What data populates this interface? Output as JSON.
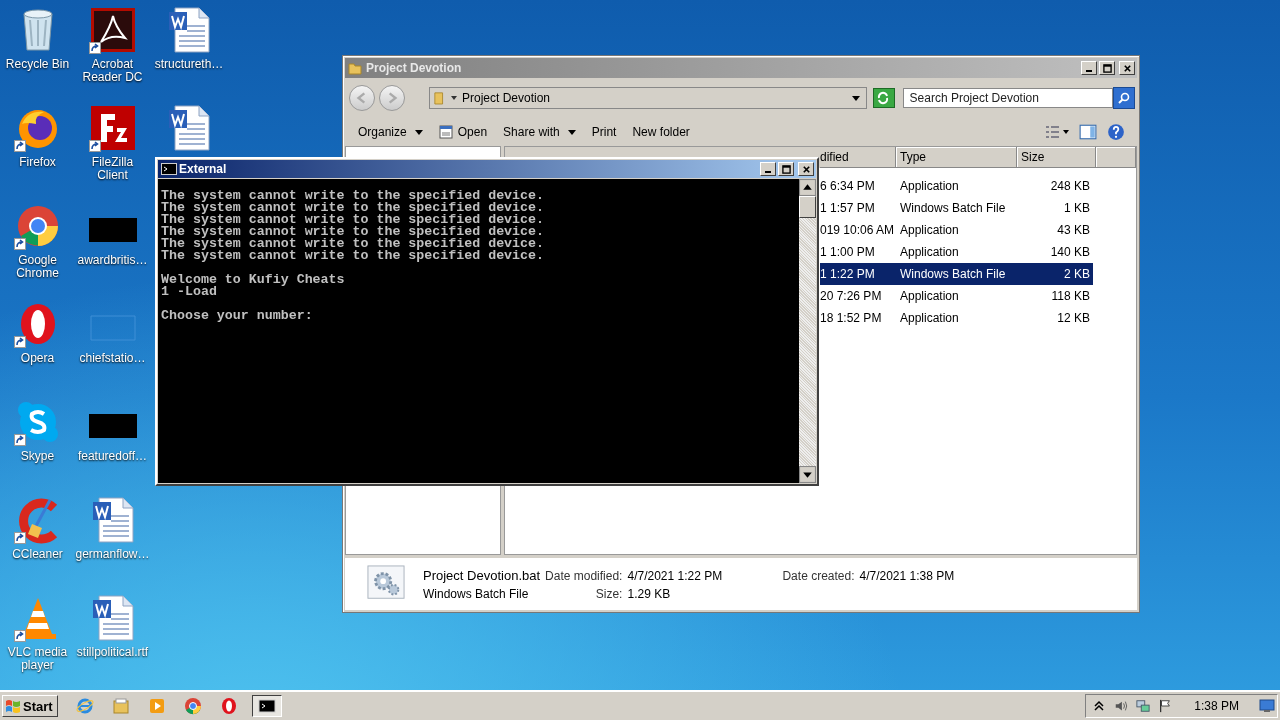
{
  "desktop_icons": [
    {
      "label": "Recycle Bin",
      "kind": "recycle",
      "shortcut": false
    },
    {
      "label": "Firefox",
      "kind": "firefox",
      "shortcut": true
    },
    {
      "label": "Google Chrome",
      "kind": "chrome",
      "shortcut": true
    },
    {
      "label": "Opera",
      "kind": "opera",
      "shortcut": true
    },
    {
      "label": "Skype",
      "kind": "skype",
      "shortcut": true
    },
    {
      "label": "CCleaner",
      "kind": "ccleaner",
      "shortcut": true
    },
    {
      "label": "VLC media player",
      "kind": "vlc",
      "shortcut": true
    },
    {
      "label": "Acrobat Reader DC",
      "kind": "acrobat",
      "shortcut": true
    },
    {
      "label": "FileZilla Client",
      "kind": "filezilla",
      "shortcut": true
    },
    {
      "label": "awardbritis…",
      "kind": "dark-thumb",
      "shortcut": false
    },
    {
      "label": "chiefstatio…",
      "kind": "light-thumb",
      "shortcut": false
    },
    {
      "label": "featuredoff…",
      "kind": "dark-thumb",
      "shortcut": false
    },
    {
      "label": "germanflow…",
      "kind": "word",
      "shortcut": false
    },
    {
      "label": "stillpolitical.rtf",
      "kind": "word",
      "shortcut": false
    },
    {
      "label": "structureth…",
      "kind": "word",
      "shortcut": false
    },
    {
      "kind": "word",
      "shortcut": false
    }
  ],
  "explorer": {
    "title": "Project Devotion",
    "address": "Project Devotion",
    "search_placeholder": "Search Project Devotion",
    "toolbar": [
      {
        "label": "Organize",
        "kind": "menu"
      },
      {
        "label": "Open",
        "kind": "open"
      },
      {
        "label": "Share with",
        "kind": "menu"
      },
      {
        "label": "Print",
        "kind": "plain"
      },
      {
        "label": "New folder",
        "kind": "plain"
      }
    ],
    "columns": [
      "dified",
      "Type",
      "Size"
    ],
    "rows": [
      {
        "date": "6 6:34 PM",
        "type": "Application",
        "size": "248 KB",
        "selected": false
      },
      {
        "date": "1 1:57 PM",
        "type": "Windows Batch File",
        "size": "1 KB",
        "selected": false
      },
      {
        "date": "019 10:06 AM",
        "type": "Application",
        "size": "43 KB",
        "selected": false
      },
      {
        "date": "1 1:00 PM",
        "type": "Application",
        "size": "140 KB",
        "selected": false
      },
      {
        "date": "1 1:22 PM",
        "type": "Windows Batch File",
        "size": "2 KB",
        "selected": true
      },
      {
        "date": "20 7:26 PM",
        "type": "Application",
        "size": "118 KB",
        "selected": false
      },
      {
        "date": "18 1:52 PM",
        "type": "Application",
        "size": "12 KB",
        "selected": false
      }
    ],
    "details": {
      "name": "Project Devotion.bat",
      "type": "Windows Batch File",
      "modified_label": "Date modified:",
      "modified": "4/7/2021 1:22 PM",
      "size_label": "Size:",
      "size": "1.29 KB",
      "created_label": "Date created:",
      "created": "4/7/2021 1:38 PM"
    }
  },
  "console": {
    "title": "External",
    "blocks": [
      [
        "The system cannot write to the specified device.",
        "The system cannot write to the specified device.",
        "The system cannot write to the specified device.",
        "The system cannot write to the specified device.",
        "The system cannot write to the specified device.",
        "The system cannot write to the specified device."
      ],
      [
        "Welcome to Kufiy Cheats",
        "1 -Load"
      ],
      [
        "Choose your number:"
      ]
    ]
  },
  "taskbar": {
    "start": "Start",
    "apps": [
      {
        "kind": "ie",
        "active": false
      },
      {
        "kind": "explorer",
        "active": false
      },
      {
        "kind": "media",
        "active": false
      },
      {
        "kind": "chrome",
        "active": false
      },
      {
        "kind": "opera",
        "active": false
      },
      {
        "kind": "cmd",
        "active": true
      }
    ],
    "time": "1:38 PM"
  }
}
